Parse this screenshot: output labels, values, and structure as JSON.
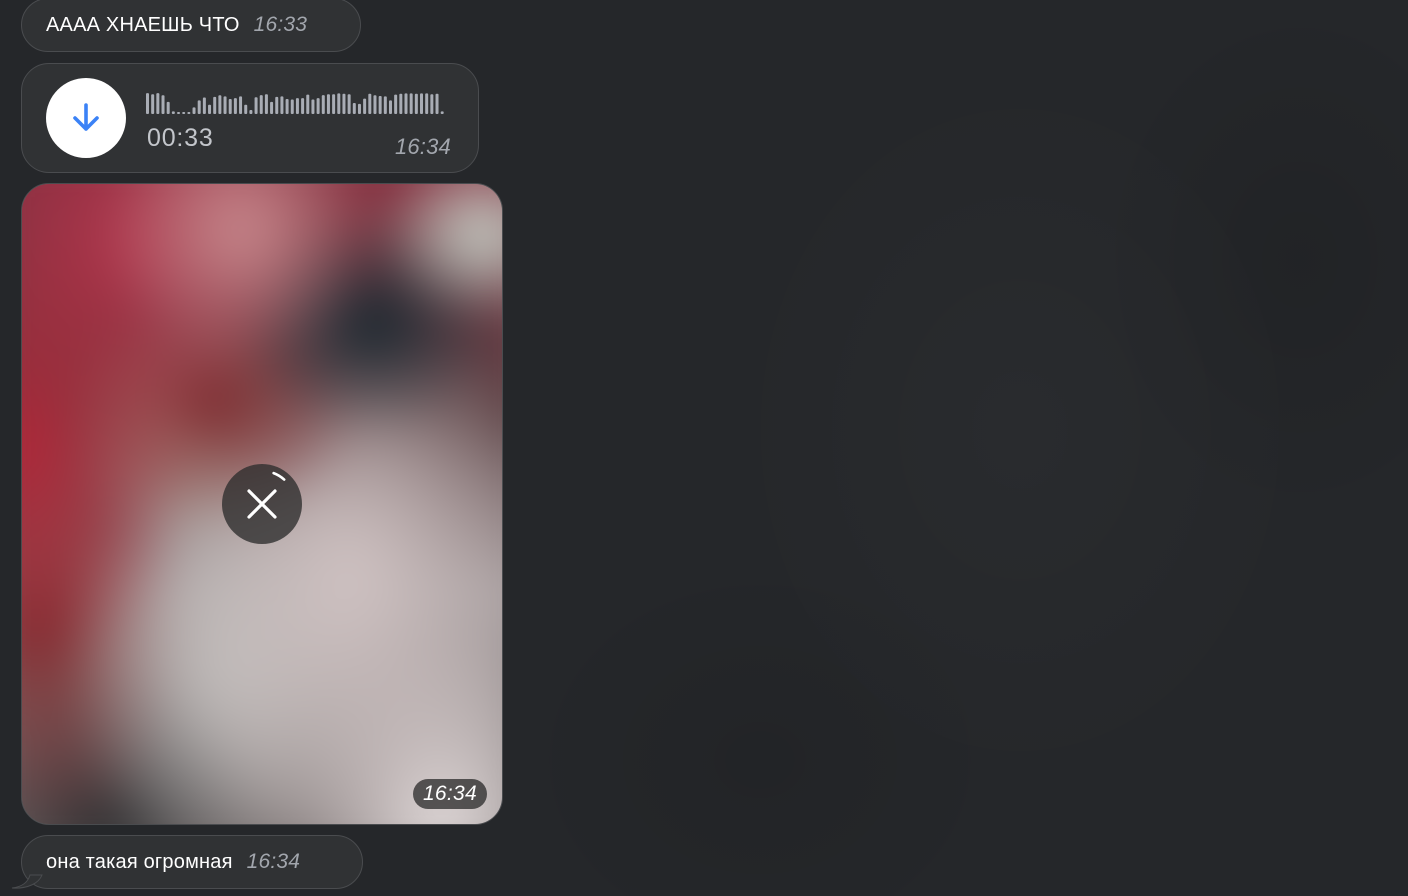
{
  "colors": {
    "background": "#25272a",
    "bubble": "#303234",
    "bubble_border": "#4a4c4f",
    "accent": "#3b82f6",
    "time": "#a2a6ad"
  },
  "messages": [
    {
      "type": "text",
      "text": "АААА ХНАЕШЬ ЧТО",
      "time": "16:33"
    },
    {
      "type": "voice",
      "duration": "00:33",
      "time": "16:34",
      "icon": "download-arrow-icon",
      "waveform_levels": [
        0.95,
        0.9,
        0.95,
        0.85,
        0.55,
        0.12,
        0.08,
        0.08,
        0.08,
        0.3,
        0.62,
        0.75,
        0.42,
        0.78,
        0.85,
        0.8,
        0.68,
        0.72,
        0.8,
        0.42,
        0.18,
        0.76,
        0.86,
        0.9,
        0.55,
        0.78,
        0.8,
        0.68,
        0.66,
        0.72,
        0.72,
        0.88,
        0.66,
        0.72,
        0.86,
        0.9,
        0.9,
        0.94,
        0.92,
        0.9,
        0.5,
        0.46,
        0.7,
        0.92,
        0.85,
        0.82,
        0.8,
        0.62,
        0.88,
        0.92,
        0.94,
        0.94,
        0.92,
        0.94,
        0.94,
        0.9,
        0.92,
        0.12
      ]
    },
    {
      "type": "photo",
      "time": "16:34",
      "cancel_icon": "close-icon",
      "download_progress": 0.06
    },
    {
      "type": "text",
      "text": "она такая огромная",
      "time": "16:34"
    }
  ]
}
